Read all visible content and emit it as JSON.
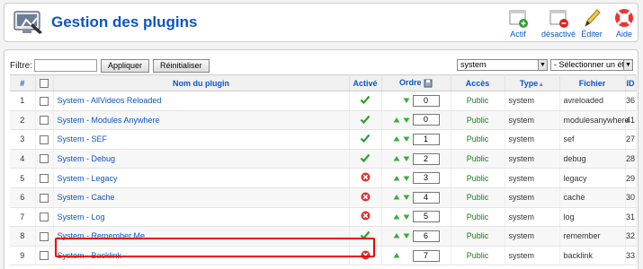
{
  "header": {
    "title": "Gestion des plugins",
    "toolbar": [
      {
        "label": "Actif",
        "icon": "activate-icon"
      },
      {
        "label": "désactivé",
        "icon": "deactivate-icon"
      },
      {
        "label": "Éditer",
        "icon": "edit-icon"
      },
      {
        "label": "Aide",
        "icon": "help-icon"
      }
    ]
  },
  "filter": {
    "label": "Filtre:",
    "value": "",
    "apply_label": "Appliquer",
    "reset_label": "Réinitialiser",
    "type_select": "system",
    "state_select": "- Sélectionner un état -"
  },
  "table": {
    "headers": {
      "num": "#",
      "name": "Nom du plugin",
      "active": "Activé",
      "order": "Ordre",
      "access": "Accès",
      "type": "Type",
      "file": "Fichier",
      "id": "ID"
    },
    "rows": [
      {
        "num": "1",
        "name": "System - AllVideos Reloaded",
        "active": true,
        "order": "0",
        "access": "Public",
        "type": "system",
        "file": "avreloaded",
        "id": "36"
      },
      {
        "num": "2",
        "name": "System - Modules Anywhere",
        "active": true,
        "order": "0",
        "access": "Public",
        "type": "system",
        "file": "modulesanywhere",
        "id": "41"
      },
      {
        "num": "3",
        "name": "System - SEF",
        "active": true,
        "order": "1",
        "access": "Public",
        "type": "system",
        "file": "sef",
        "id": "27"
      },
      {
        "num": "4",
        "name": "System - Debug",
        "active": true,
        "order": "2",
        "access": "Public",
        "type": "system",
        "file": "debug",
        "id": "28"
      },
      {
        "num": "5",
        "name": "System - Legacy",
        "active": false,
        "order": "3",
        "access": "Public",
        "type": "system",
        "file": "legacy",
        "id": "29"
      },
      {
        "num": "6",
        "name": "System - Cache",
        "active": false,
        "order": "4",
        "access": "Public",
        "type": "system",
        "file": "cache",
        "id": "30"
      },
      {
        "num": "7",
        "name": "System - Log",
        "active": false,
        "order": "5",
        "access": "Public",
        "type": "system",
        "file": "log",
        "id": "31"
      },
      {
        "num": "8",
        "name": "System - Remember Me",
        "active": true,
        "order": "6",
        "access": "Public",
        "type": "system",
        "file": "remember",
        "id": "32"
      },
      {
        "num": "9",
        "name": "System - Backlink",
        "active": false,
        "order": "7",
        "access": "Public",
        "type": "system",
        "file": "backlink",
        "id": "33"
      }
    ]
  },
  "colors": {
    "accent": "#0b55c4",
    "public": "#1a7a1a",
    "highlight": "#e00000"
  }
}
